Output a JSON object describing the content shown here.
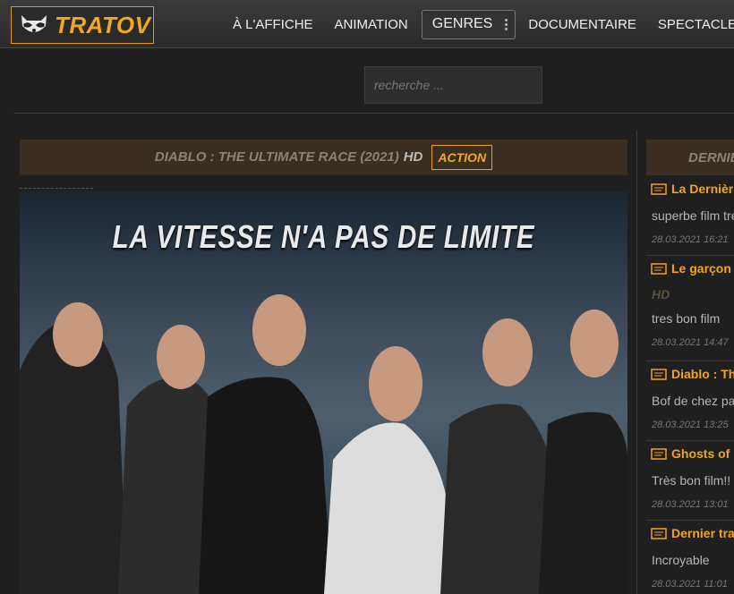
{
  "header": {
    "logo_text": "TRATOV",
    "nav": [
      "À L'AFFICHE",
      "ANIMATION",
      "GENRES",
      "DOCUMENTAIRE",
      "SPECTACLE"
    ]
  },
  "search": {
    "placeholder": "recherche ..."
  },
  "movie": {
    "title": "DIABLO : THE ULTIMATE RACE (2021)",
    "quality": "HD",
    "genre": "ACTION",
    "poster_tagline": "LA VITESSE N'A PAS DE LIMITE"
  },
  "sidebar": {
    "title": "DERNIERS COMMENTAIRES",
    "comments": [
      {
        "title": "La Dernière",
        "hd": "",
        "text": "superbe film tres",
        "date": "28.03.2021 16:21"
      },
      {
        "title": "Le garçon",
        "hd": "HD",
        "text": "tres bon film",
        "date": "28.03.2021 14:47"
      },
      {
        "title": "Diablo : The",
        "hd": "",
        "text": "Bof de chez pas",
        "date": "28.03.2021 13:25"
      },
      {
        "title": "Ghosts of",
        "hd": "",
        "text": "Très bon film!!",
        "date": "28.03.2021 13:01"
      },
      {
        "title": "Dernier train",
        "hd": "",
        "text": "Incroyable",
        "date": "28.03.2021 11:01"
      }
    ]
  },
  "colors": {
    "accent": "#f2a41f",
    "bar": "#3a2e22",
    "bg": "#1f1f1f"
  }
}
